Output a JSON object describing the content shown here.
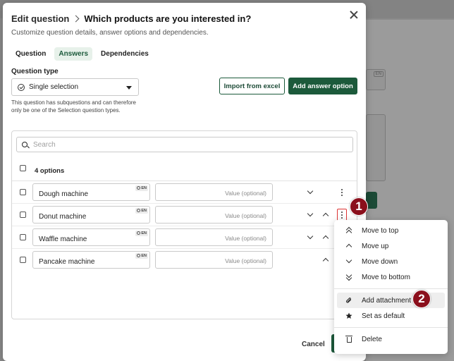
{
  "modal": {
    "breadcrumb": "Edit question",
    "title": "Which products are you interested in?",
    "subtitle": "Customize question details, answer options and dependencies.",
    "tabs": [
      {
        "label": "Question",
        "active": false
      },
      {
        "label": "Answers",
        "active": true
      },
      {
        "label": "Dependencies",
        "active": false
      }
    ],
    "question_type": {
      "label": "Question type",
      "selected": "Single selection",
      "note": "This question has subquestions and can therefore only be one of the Selection question types."
    },
    "import_button": "Import from excel",
    "add_option_button": "Add answer option",
    "search_placeholder": "Search",
    "options_count": "4 options",
    "language_tag": "EN",
    "value_placeholder": "Value (optional)",
    "options": [
      {
        "name": "Dough machine"
      },
      {
        "name": "Donut machine"
      },
      {
        "name": "Waffle machine"
      },
      {
        "name": "Pancake machine"
      }
    ],
    "cancel_button": "Cancel"
  },
  "context_menu": {
    "items": [
      {
        "label": "Move to top",
        "icon": "double-chevron-up-icon"
      },
      {
        "label": "Move up",
        "icon": "chevron-up-icon"
      },
      {
        "label": "Move down",
        "icon": "chevron-down-icon"
      },
      {
        "label": "Move to bottom",
        "icon": "double-chevron-down-icon"
      },
      {
        "label": "Add attachment",
        "icon": "paperclip-icon"
      },
      {
        "label": "Set as default",
        "icon": "star-icon"
      },
      {
        "label": "Delete",
        "icon": "trash-icon"
      }
    ]
  },
  "callouts": [
    "1",
    "2"
  ],
  "background": {
    "language_tag": "EN"
  },
  "colors": {
    "primary": "#1c5a3b",
    "active_tab_bg": "#e7f1ea",
    "callout": "#8b0f1c",
    "highlight_border": "#dd3333"
  }
}
